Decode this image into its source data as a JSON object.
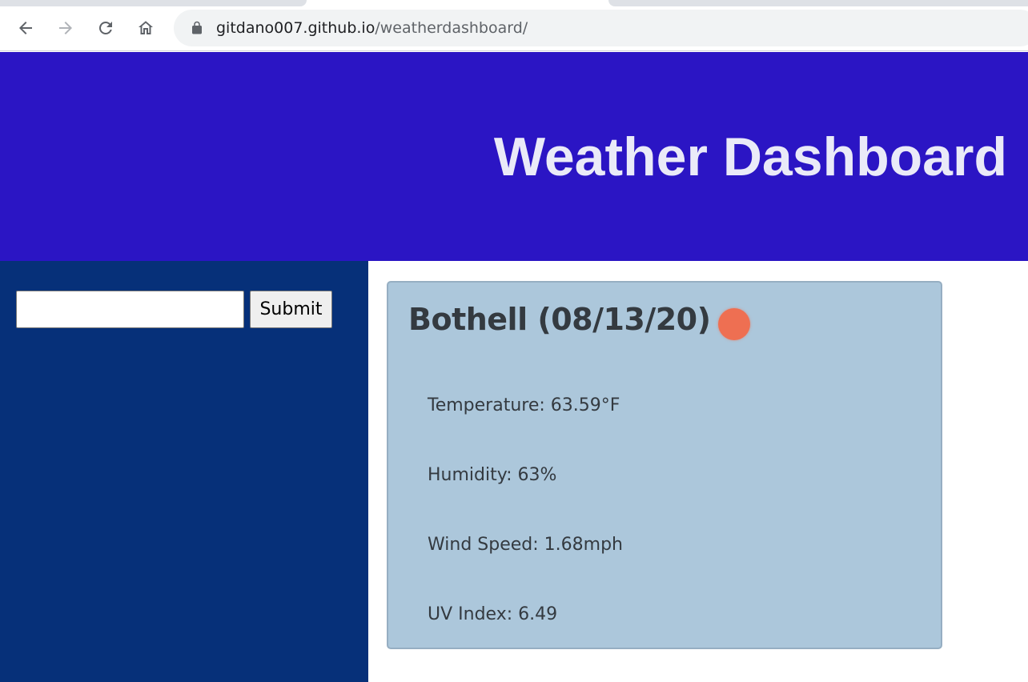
{
  "browser": {
    "url_host": "gitdano007.github.io",
    "url_path": "/weatherdashboard/"
  },
  "header": {
    "title": "Weather Dashboard"
  },
  "search": {
    "value": "",
    "submit_label": "Submit"
  },
  "current": {
    "title": "Bothell (08/13/20)",
    "icon": "sun-icon",
    "icon_color": "#ee6f52",
    "temperature": "Temperature: 63.59°F",
    "humidity": "Humidity: 63%",
    "wind_speed": "Wind Speed: 1.68mph",
    "uv_index": "UV Index: 6.49"
  },
  "colors": {
    "header_bg": "#2b15c4",
    "sidebar_bg": "#063079",
    "card_bg": "#acc7db"
  }
}
